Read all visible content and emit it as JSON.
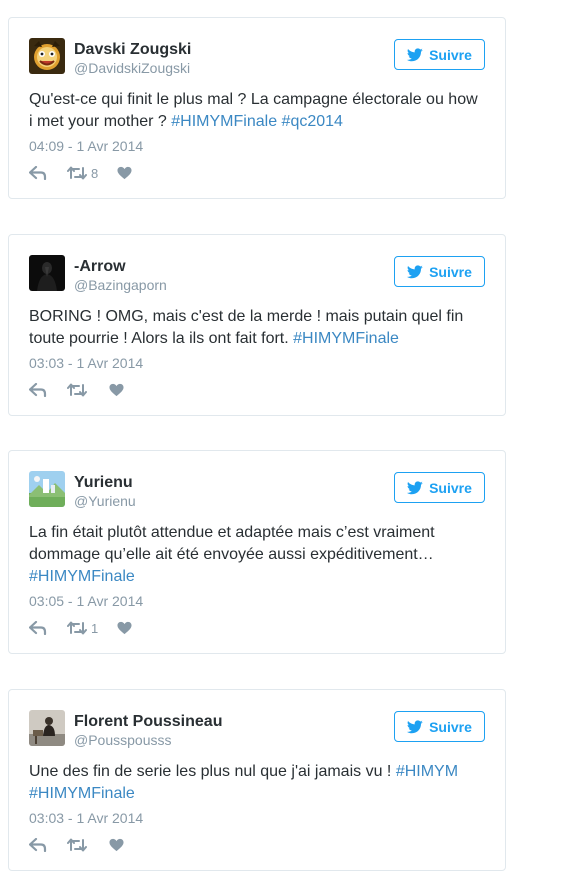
{
  "colors": {
    "accent": "#1da1f2",
    "hashtag": "#3b88c3",
    "muted": "#8899a6",
    "text": "#292f33"
  },
  "tweets": [
    {
      "name": "Davski Zougski",
      "handle": "@DavidskiZougski",
      "follow_label": "Suivre",
      "text_parts": [
        "Qu'est-ce qui finit le plus mal ? La campagne électorale ou how i met your mother ? ",
        "#HIMYMFinale",
        " ",
        "#qc2014"
      ],
      "timestamp": "04:09 - 1 Avr 2014",
      "retweet_count": "8",
      "avatar_icon": "cartoon-face-avatar"
    },
    {
      "name": "-Arrow",
      "handle": "@Bazingaporn",
      "follow_label": "Suivre",
      "text_parts": [
        "BORING ! OMG, mais c'est de la merde ! mais putain quel fin toute pourrie ! Alors la ils ont fait fort. ",
        "#HIMYMFinale"
      ],
      "timestamp": "03:03 - 1 Avr 2014",
      "retweet_count": "",
      "avatar_icon": "dark-figure-avatar"
    },
    {
      "name": "Yurienu",
      "handle": "@Yurienu",
      "follow_label": "Suivre",
      "text_parts": [
        "La fin était plutôt attendue et adaptée mais c’est vraiment dommage qu’elle ait été envoyée aussi expéditivement… ",
        "#HIMYMFinale"
      ],
      "timestamp": "03:05 - 1 Avr 2014",
      "retweet_count": "1",
      "avatar_icon": "landscape-avatar"
    },
    {
      "name": "Florent Poussineau",
      "handle": "@Pousspousss",
      "follow_label": "Suivre",
      "text_parts": [
        "Une des fin de serie les plus nul que j'ai jamais vu ! ",
        "#HIMYM",
        " ",
        "#HIMYMFinale"
      ],
      "timestamp": "03:03 - 1 Avr 2014",
      "retweet_count": "",
      "avatar_icon": "person-photo-avatar"
    }
  ]
}
